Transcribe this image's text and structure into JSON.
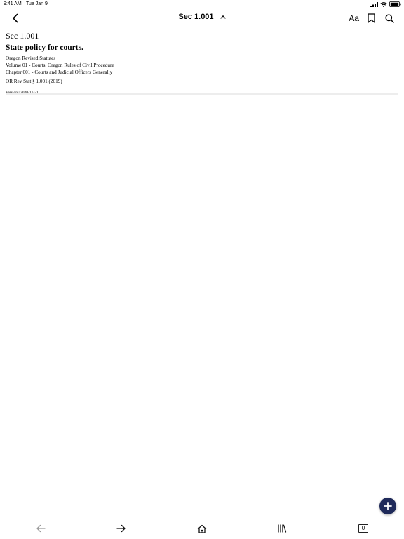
{
  "status_bar": {
    "time": "9:41 AM",
    "date": "Tue Jan 9",
    "icons": [
      "cellular-signal-icon",
      "wifi-icon",
      "battery-icon"
    ]
  },
  "nav": {
    "back_icon": "chevron-left-icon",
    "title": "Sec 1.001",
    "title_toggle_icon": "chevron-up-icon",
    "text_size_label": "Aa",
    "bookmark_icon": "bookmark-icon",
    "search_icon": "search-icon"
  },
  "document": {
    "section_number": "Sec 1.001",
    "section_title": "State policy for courts.",
    "breadcrumbs": [
      "Oregon Revised Statutes",
      "Volume 01 - Courts, Oregon Rules of Civil Procedure",
      "Chapter 001 - Courts and Judicial Officers Generally"
    ],
    "citation": "OR Rev Stat § 1.001 (2019)",
    "version": "Version | 2020-11-21"
  },
  "fab": {
    "icon": "plus-icon",
    "color": "#1f2a5a"
  },
  "tab_bar": {
    "items": [
      {
        "name": "back",
        "icon": "arrow-left-icon",
        "enabled": false
      },
      {
        "name": "forward",
        "icon": "arrow-right-icon",
        "enabled": true
      },
      {
        "name": "home",
        "icon": "home-icon",
        "enabled": true
      },
      {
        "name": "library",
        "icon": "library-icon",
        "enabled": true
      },
      {
        "name": "tabs",
        "icon": "tabs-count-icon",
        "enabled": true
      }
    ],
    "tabs_count": "0"
  }
}
